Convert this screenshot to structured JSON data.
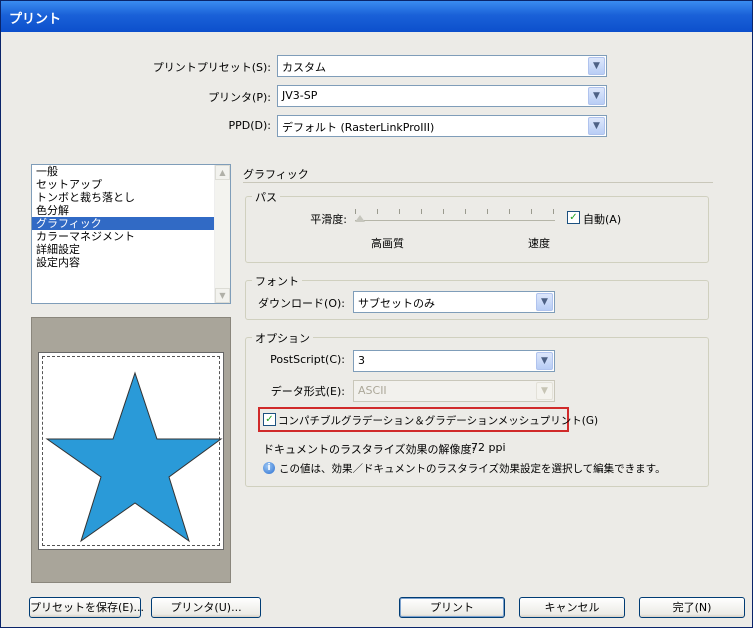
{
  "window": {
    "title": "プリント"
  },
  "top": {
    "preset_label": "プリントプリセット(S):",
    "preset_value": "カスタム",
    "printer_label": "プリンタ(P):",
    "printer_value": "JV3-SP",
    "ppd_label": "PPD(D):",
    "ppd_value": "デフォルト (RasterLinkProIII)"
  },
  "sidebar": {
    "items": [
      {
        "label": "一般"
      },
      {
        "label": "セットアップ"
      },
      {
        "label": "トンボと裁ち落とし"
      },
      {
        "label": "色分解"
      },
      {
        "label": "グラフィック",
        "selected": true
      },
      {
        "label": "カラーマネジメント"
      },
      {
        "label": "詳細設定"
      },
      {
        "label": "設定内容"
      }
    ]
  },
  "graphics": {
    "section_title": "グラフィック",
    "path": {
      "legend": "パス",
      "flatness_label": "平滑度:",
      "auto_label": "自動(A)",
      "auto_checked": true,
      "low_label": "高画質",
      "high_label": "速度"
    },
    "font": {
      "legend": "フォント",
      "download_label": "ダウンロード(O):",
      "download_value": "サブセットのみ"
    },
    "options": {
      "legend": "オプション",
      "postscript_label": "PostScript(C):",
      "postscript_value": "3",
      "data_format_label": "データ形式(E):",
      "data_format_value": "ASCII",
      "compat_label": "コンパチブルグラデーション＆グラデーションメッシュプリント(G)",
      "compat_checked": true,
      "resolution_label": "ドキュメントのラスタライズ効果の解像度:",
      "resolution_value": "72 ppi",
      "info_text": "この値は、効果／ドキュメントのラスタライズ効果設定を選択して編集できます。"
    }
  },
  "buttons": {
    "save_preset": "プリセットを保存(E)...",
    "printer": "プリンタ(U)...",
    "print": "プリント",
    "cancel": "キャンセル",
    "done": "完了(N)"
  },
  "colors": {
    "title_bar": "#1a61d8",
    "selection": "#316ac5",
    "star_fill": "#2a9ad8",
    "highlight_box": "#d02a2a"
  }
}
